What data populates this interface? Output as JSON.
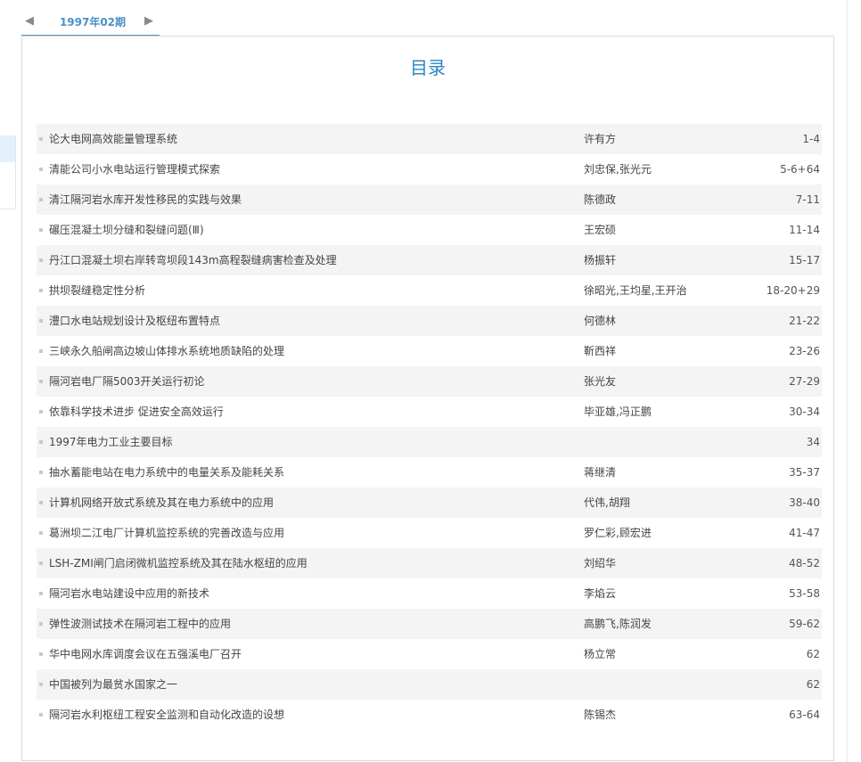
{
  "issue_nav": {
    "prev_icon": "triangle-left-icon",
    "label": "1997年02期",
    "next_icon": "triangle-right-icon"
  },
  "toc": {
    "title": "目录",
    "rows": [
      {
        "title": "论大电网高效能量管理系统",
        "author": "许有方",
        "pages": "1-4"
      },
      {
        "title": "清能公司小水电站运行管理模式探索",
        "author": "刘忠保,张光元",
        "pages": "5-6+64"
      },
      {
        "title": "清江隔河岩水库开发性移民的实践与效果",
        "author": "陈德政",
        "pages": "7-11"
      },
      {
        "title": "碾压混凝土坝分缝和裂缝问题(Ⅲ)",
        "author": "王宏硕",
        "pages": "11-14"
      },
      {
        "title": "丹江口混凝土坝右岸转弯坝段143m高程裂缝病害检查及处理",
        "author": "杨振轩",
        "pages": "15-17"
      },
      {
        "title": "拱坝裂缝稳定性分析",
        "author": "徐昭光,王均星,王开治",
        "pages": "18-20+29"
      },
      {
        "title": "澧口水电站规划设计及枢纽布置特点",
        "author": "何德林",
        "pages": "21-22"
      },
      {
        "title": "三峡永久船闸高边坡山体排水系统地质缺陷的处理",
        "author": "靳西祥",
        "pages": "23-26"
      },
      {
        "title": "隔河岩电厂隔5003开关运行初论",
        "author": "张光友",
        "pages": "27-29"
      },
      {
        "title": "依靠科学技术进步 促进安全高效运行",
        "author": "毕亚雄,冯正鹏",
        "pages": "30-34"
      },
      {
        "title": "1997年电力工业主要目标",
        "author": "",
        "pages": "34"
      },
      {
        "title": "抽水蓄能电站在电力系统中的电量关系及能耗关系",
        "author": "蒋继清",
        "pages": "35-37"
      },
      {
        "title": "计算机网络开放式系统及其在电力系统中的应用",
        "author": "代伟,胡翔",
        "pages": "38-40"
      },
      {
        "title": "葛洲坝二江电厂计算机监控系统的完善改造与应用",
        "author": "罗仁彩,顾宏进",
        "pages": "41-47"
      },
      {
        "title": "LSH-ZMI闸门启闭微机监控系统及其在陆水枢纽的应用",
        "author": "刘绍华",
        "pages": "48-52"
      },
      {
        "title": "隔河岩水电站建设中应用的新技术",
        "author": "李焰云",
        "pages": "53-58"
      },
      {
        "title": "弹性波测试技术在隔河岩工程中的应用",
        "author": "高鹏飞,陈润发",
        "pages": "59-62"
      },
      {
        "title": "华中电网水库调度会议在五强溪电厂召开",
        "author": "杨立常",
        "pages": "62"
      },
      {
        "title": "中国被列为最贫水国家之一",
        "author": "",
        "pages": "62"
      },
      {
        "title": "隔河岩水利枢纽工程安全监测和自动化改造的设想",
        "author": "陈锡杰",
        "pages": "63-64"
      }
    ]
  }
}
